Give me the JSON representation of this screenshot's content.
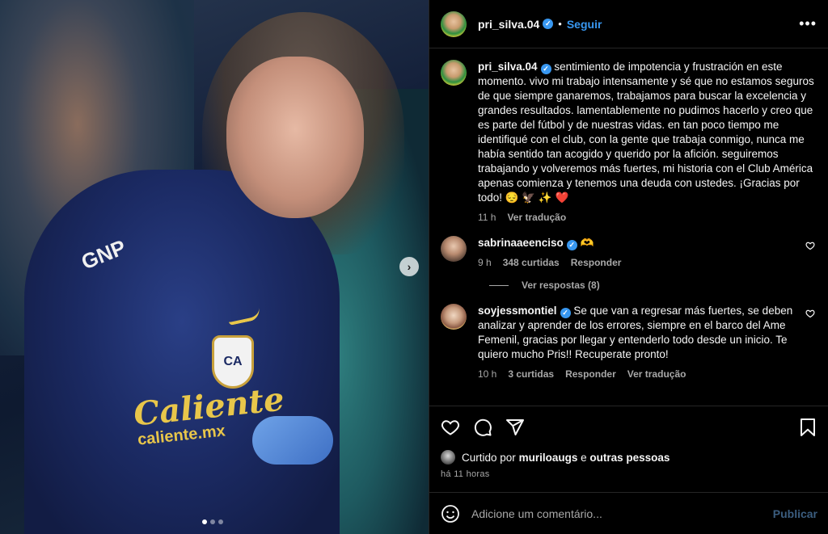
{
  "post": {
    "username": "pri_silva.04",
    "separator": "•",
    "follow_label": "Seguir",
    "more_label": "•••"
  },
  "media": {
    "sponsor": "Caliente",
    "sponsor_sub": "caliente.mx",
    "gnp": "GNP",
    "crest": "CA",
    "next_label": "›",
    "slides": 3,
    "active_slide": 1
  },
  "caption": {
    "username": "pri_silva.04",
    "text": "sentimiento de impotencia y frustración en este momento. vivo mi trabajo intensamente y sé que no estamos seguros de que siempre ganaremos, trabajamos para buscar la excelencia y grandes resultados. lamentablemente no pudimos hacerlo y creo que es parte del fútbol y de nuestras vidas. en tan poco tiempo me identifiqué con el club, con la gente que trabaja conmigo, nunca me había sentido tan acogido y querido por la afición. seguiremos trabajando y volveremos más fuertes, mi historia con el Club América apenas comienza y tenemos una deuda con ustedes. ¡Gracias por todo! 😔 🦅 ✨ ❤️",
    "time": "11 h",
    "translate": "Ver tradução"
  },
  "comments": [
    {
      "username": "sabrinaaeenciso",
      "text": "🫶",
      "time": "9 h",
      "likes": "348 curtidas",
      "reply": "Responder",
      "replies_label": "Ver respostas (8)"
    },
    {
      "username": "soyjessmontiel",
      "text": "Se que van a regresar más fuertes, se deben analizar y aprender de los errores, siempre en el barco del Ame Femenil, gracias por llegar y entenderlo todo desde un inicio. Te quiero mucho Pris!! Recuperate pronto!",
      "time": "10 h",
      "likes": "3 curtidas",
      "reply": "Responder",
      "translate": "Ver tradução"
    }
  ],
  "likes": {
    "prefix": "Curtido por",
    "user": "muriloaugs",
    "conjunction": "e",
    "others": "outras pessoas"
  },
  "posted_time": "há 11 horas",
  "add_comment": {
    "placeholder": "Adicione um comentário...",
    "publish_label": "Publicar"
  },
  "colors": {
    "background": "#000000",
    "accent": "#3897f0",
    "muted": "#a8a8a8"
  }
}
